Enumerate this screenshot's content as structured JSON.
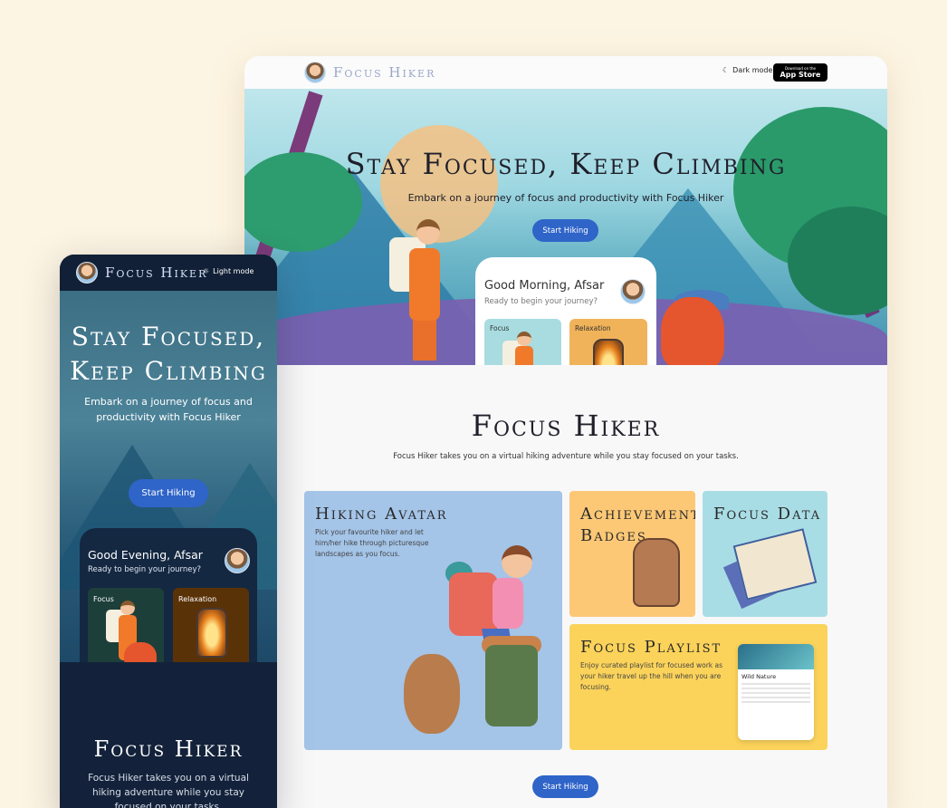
{
  "desktop": {
    "nav": {
      "logo_text": "Focus Hiker",
      "dark_mode_label": "Dark mode",
      "appstore_small": "Download on the",
      "appstore_big": "App Store"
    },
    "hero": {
      "title": "Stay Focused, Keep Climbing",
      "subtitle": "Embark on a journey of focus and productivity with Focus Hiker",
      "cta": "Start Hiking",
      "card": {
        "greeting": "Good Morning, Afsar",
        "ready": "Ready to begin your journey?",
        "tiles": [
          "Focus",
          "Relaxation"
        ]
      }
    },
    "features": {
      "title": "Focus Hiker",
      "subtitle": "Focus Hiker takes you on a virtual hiking adventure while you stay focused on your tasks.",
      "items": [
        {
          "title": "Hiking Avatar",
          "desc": "Pick your favourite hiker and let him/her hike through picturesque landscapes as you focus."
        },
        {
          "title": "Achievement Badges",
          "desc": ""
        },
        {
          "title": "Focus Data",
          "desc": ""
        },
        {
          "title": "Focus Playlist",
          "desc": "Enjoy curated playlist for focused work as your hiker travel up the hill when you are focusing."
        }
      ],
      "playlist_card": {
        "title": "Wild Nature"
      },
      "cta": "Start Hiking"
    },
    "colors": {
      "primary_button": "#2f64c8",
      "avatar_tile": "#a4c4e8",
      "badges_tile": "#fcc876",
      "data_tile": "#a9dde5",
      "playlist_tile": "#fbd35a"
    }
  },
  "mobile": {
    "nav": {
      "logo_text": "Focus Hiker",
      "light_mode_label": "Light mode"
    },
    "hero": {
      "title": "Stay Focused, Keep Climbing",
      "subtitle": "Embark on a journey of focus and productivity with Focus Hiker",
      "cta": "Start Hiking",
      "card": {
        "greeting": "Good Evening, Afsar",
        "ready": "Ready to begin your journey?",
        "tiles": [
          "Focus",
          "Relaxation"
        ]
      }
    },
    "section": {
      "title": "Focus Hiker",
      "subtitle": "Focus Hiker takes you on a virtual hiking adventure while you stay focused on your tasks."
    }
  }
}
